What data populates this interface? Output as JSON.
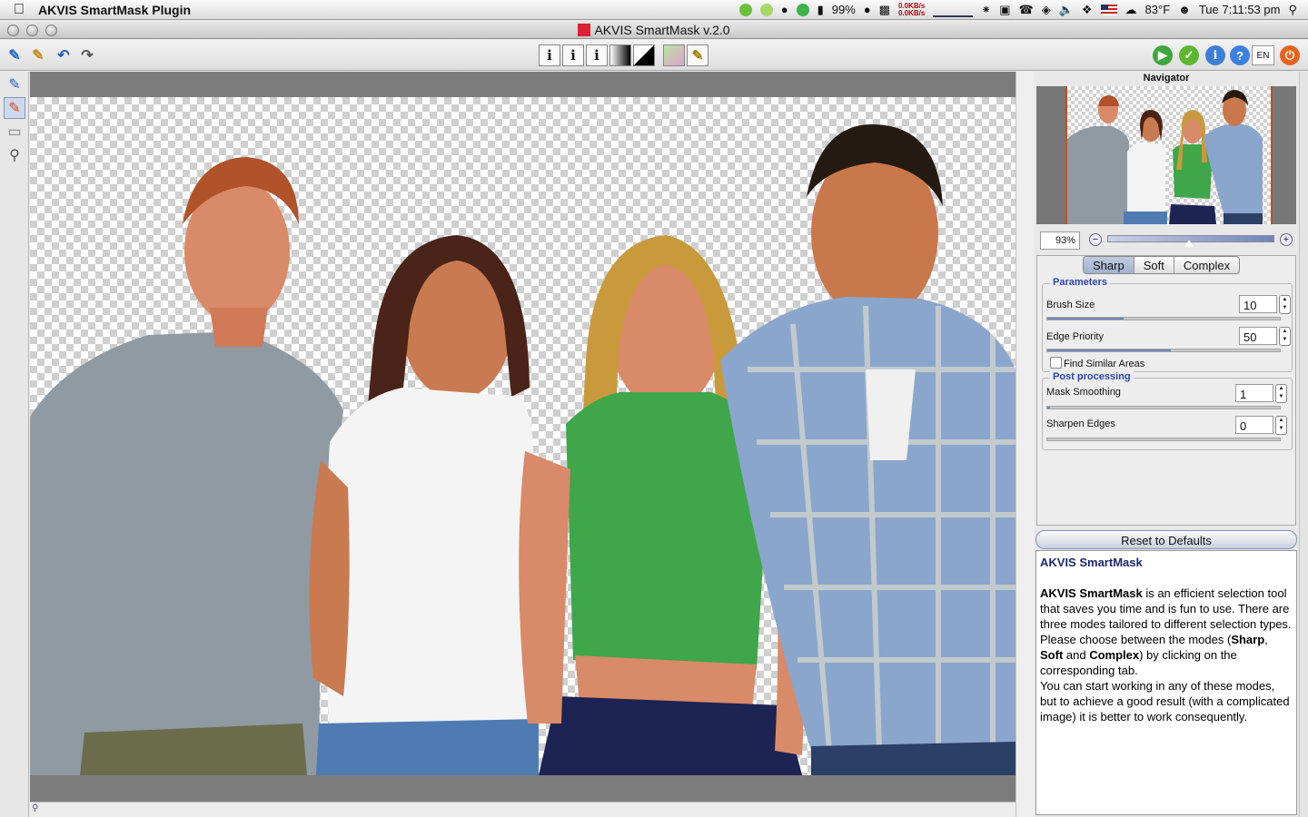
{
  "menubar": {
    "app_name": "AKVIS SmartMask Plugin",
    "battery": "99%",
    "net_up": "0.0KB/s",
    "net_down": "0.0KB/s",
    "temperature": "83°F",
    "clock": "Tue 7:11:53 pm"
  },
  "window": {
    "title": "AKVIS SmartMask v.2.0"
  },
  "toolbar": {
    "language": "EN"
  },
  "navigator": {
    "title": "Navigator",
    "zoom": "93%",
    "zoom_slider_value": 0.49
  },
  "modes": {
    "tabs": [
      "Sharp",
      "Soft",
      "Complex"
    ],
    "selected": "Sharp"
  },
  "parameters": {
    "title": "Parameters",
    "brush_size": {
      "label": "Brush Size",
      "value": "10",
      "fraction": 0.33
    },
    "edge_priority": {
      "label": "Edge Priority",
      "value": "50",
      "fraction": 0.53
    },
    "find_similar": {
      "label": "Find Similar Areas",
      "checked": false
    }
  },
  "post_processing": {
    "title": "Post processing",
    "mask_smoothing": {
      "label": "Mask Smoothing",
      "value": "1",
      "fraction": 0.01
    },
    "sharpen_edges": {
      "label": "Sharpen Edges",
      "value": "0",
      "fraction": 0.0
    }
  },
  "reset": {
    "label": "Reset to Defaults"
  },
  "help": {
    "title": "AKVIS SmartMask",
    "p1_bold": "AKVIS SmartMask",
    "p1_rest": " is an efficient selection tool that saves you time and is fun to use. There are three modes tailored to different selection types. Please choose between the modes (",
    "m_sharp": "Sharp",
    "comma": ", ",
    "m_soft": "Soft",
    "and": " and ",
    "m_complex": "Complex",
    "p1_end": ") by clicking on the corresponding tab.",
    "p2": "You can start working in any of these modes, but to achieve a good result (with a complicated image) it is better to work consequently."
  },
  "colors": {
    "shirt_gray": "#8f9aa3",
    "shirt_white": "#f4f4f4",
    "shirt_green": "#3fa64a",
    "shirt_plaid": "#8aa6cc",
    "skin": "#d98a68",
    "accent_blue": "#6f86b8"
  }
}
